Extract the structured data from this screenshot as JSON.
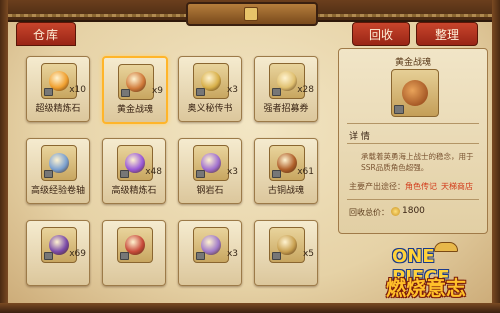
{
  "tabs": {
    "warehouse": "仓库"
  },
  "header_buttons": {
    "recycle": "回收",
    "arrange": "整理"
  },
  "colors": {
    "accent_red": "#b8321c",
    "selected_border": "#ffb52a",
    "link": "#d23a1a"
  },
  "items": [
    {
      "name": "超级精炼石",
      "count": "x10",
      "icon": "orange-stone-icon",
      "color": "#f0a030",
      "selected": false
    },
    {
      "name": "黄金战魂",
      "count": "x9",
      "icon": "golden-soul-icon",
      "color": "#d07a3a",
      "selected": true
    },
    {
      "name": "奥义秘传书",
      "count": "x3",
      "icon": "secret-book-icon",
      "color": "#d8b04a",
      "selected": false
    },
    {
      "name": "强者招募券",
      "count": "x28",
      "icon": "recruit-ticket-icon",
      "color": "#e0c070",
      "selected": false
    },
    {
      "name": "高级经验卷轴",
      "count": "",
      "icon": "scroll-icon",
      "color": "#7aa0d0",
      "selected": false
    },
    {
      "name": "高级精炼石",
      "count": "x48",
      "icon": "purple-crystal-icon",
      "color": "#9a5ad8",
      "selected": false
    },
    {
      "name": "钢岩石",
      "count": "x3",
      "icon": "steel-rock-icon",
      "color": "#a070d0",
      "selected": false
    },
    {
      "name": "古铜战魂",
      "count": "x61",
      "icon": "bronze-soul-icon",
      "color": "#b0602a",
      "selected": false
    },
    {
      "name": "",
      "count": "x69",
      "icon": "purple-book-icon",
      "color": "#7a4aa8",
      "selected": false
    },
    {
      "name": "",
      "count": "",
      "icon": "red-book-icon",
      "color": "#c84a3a",
      "selected": false
    },
    {
      "name": "",
      "count": "x3",
      "icon": "purple-orb-icon",
      "color": "#a07ac8",
      "selected": false
    },
    {
      "name": "",
      "count": "x5",
      "icon": "gold-book-icon",
      "color": "#c8a050",
      "selected": false
    }
  ],
  "detail": {
    "title": "黄金战魂",
    "section_label": "详 情",
    "description": "承载着英勇海上战士的稳念，用于SSR品质角色超强。",
    "source_label": "主要产出途径：",
    "source_links": [
      "角色传记",
      "天梯商店"
    ],
    "price_label": "回收总价：",
    "price": "1800"
  },
  "logo": {
    "latin": "ONE PIECE",
    "title": "燃烧意志"
  }
}
